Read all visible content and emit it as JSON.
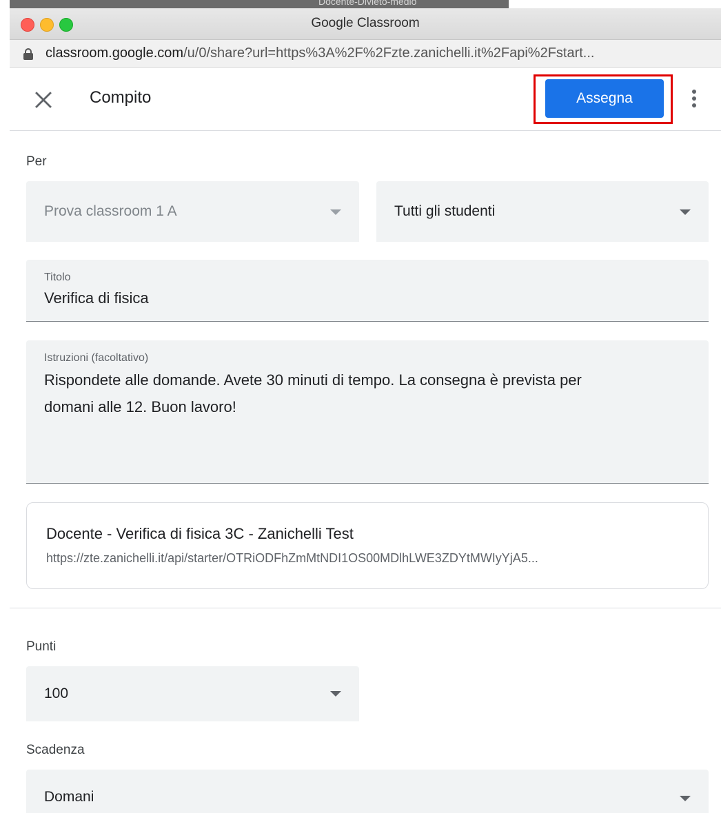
{
  "browser": {
    "background_title": "Docente-Divieto-medio",
    "window_title": "Google Classroom",
    "url_host": "classroom.google.com",
    "url_path": "/u/0/share?url=https%3A%2F%2Fzte.zanichelli.it%2Fapi%2Fstart..."
  },
  "header": {
    "title": "Compito",
    "assign_label": "Assegna",
    "close_icon": "close-icon",
    "more_icon": "more-vert-icon"
  },
  "for_section": {
    "label": "Per",
    "class_select": "Prova classroom 1 A",
    "students_select": "Tutti gli studenti"
  },
  "title_field": {
    "label": "Titolo",
    "value": "Verifica di fisica"
  },
  "instructions_field": {
    "label": "Istruzioni (facoltativo)",
    "line1": "Rispondete alle domande. Avete 30 minuti di tempo. La consegna è prevista per",
    "line2": "domani alle 12. Buon lavoro!"
  },
  "attachment": {
    "title": "Docente - Verifica di fisica 3C - Zanichelli Test",
    "url": "https://zte.zanichelli.it/api/starter/OTRiODFhZmMtNDI1OS00MDlhLWE3ZDYtMWIyYjA5..."
  },
  "points": {
    "label": "Punti",
    "value": "100"
  },
  "due": {
    "label": "Scadenza",
    "value": "Domani"
  },
  "colors": {
    "accent": "#1a73e8",
    "highlight": "#e00000"
  }
}
